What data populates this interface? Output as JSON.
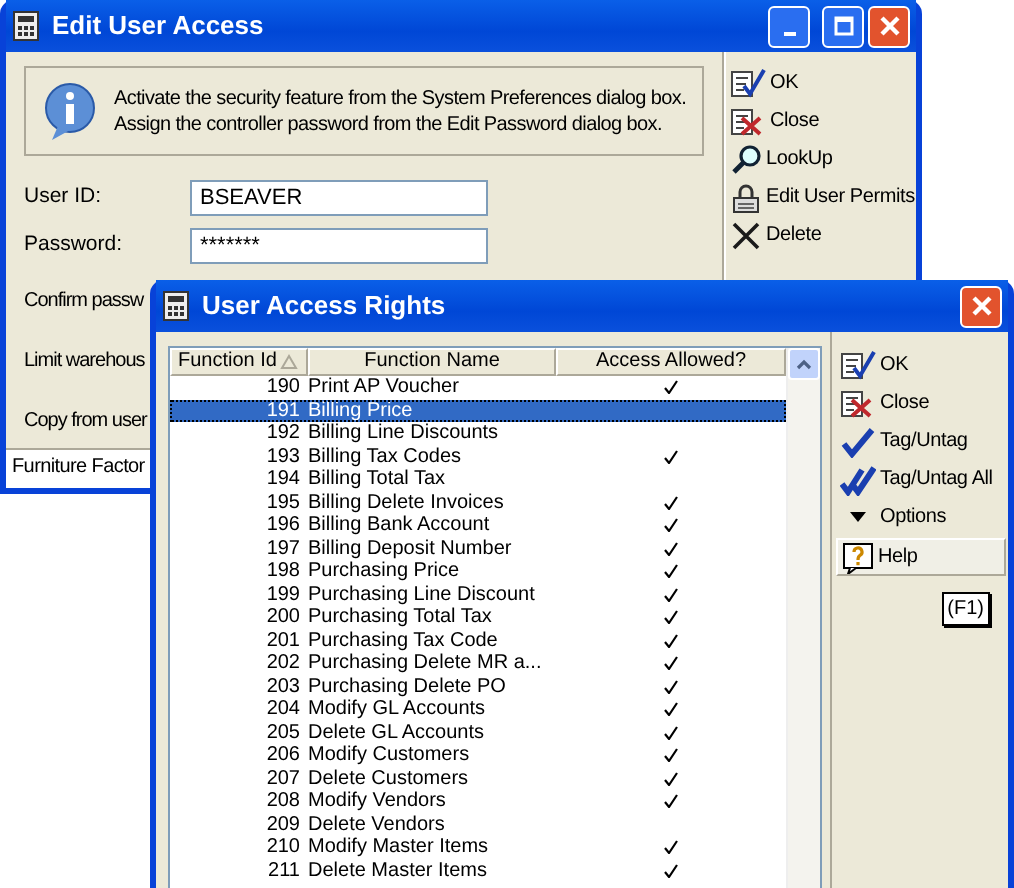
{
  "edit_window": {
    "title": "Edit User Access",
    "info": [
      "Activate the security feature from the System Preferences dialog box.",
      "Assign the controller password from the Edit Password dialog box."
    ],
    "fields": [
      {
        "label": "User ID:",
        "value": "BSEAVER"
      },
      {
        "label": "Password:",
        "value": "*******"
      }
    ],
    "labels": [
      "Confirm passw",
      "Limit warehous",
      "Copy from user"
    ],
    "status": "Furniture Factor",
    "buttons": [
      {
        "label": "OK",
        "kind": "ok"
      },
      {
        "label": "Close",
        "kind": "close"
      },
      {
        "label": "LookUp",
        "kind": "lookup"
      },
      {
        "label": "Edit User Permits",
        "kind": "permits"
      },
      {
        "label": "Delete",
        "kind": "delete"
      }
    ]
  },
  "rights_window": {
    "title": "User Access Rights",
    "columns": [
      "Function Id",
      "Function Name",
      "Access Allowed?"
    ],
    "rows": [
      {
        "id": "190",
        "name": "Print AP Voucher",
        "allowed": true,
        "selected": false
      },
      {
        "id": "191",
        "name": "Billing Price",
        "allowed": false,
        "selected": true
      },
      {
        "id": "192",
        "name": "Billing Line Discounts",
        "allowed": false,
        "selected": false
      },
      {
        "id": "193",
        "name": "Billing Tax Codes",
        "allowed": true,
        "selected": false
      },
      {
        "id": "194",
        "name": "Billing Total Tax",
        "allowed": false,
        "selected": false
      },
      {
        "id": "195",
        "name": "Billing Delete Invoices",
        "allowed": true,
        "selected": false
      },
      {
        "id": "196",
        "name": "Billing Bank Account",
        "allowed": true,
        "selected": false
      },
      {
        "id": "197",
        "name": "Billing Deposit Number",
        "allowed": true,
        "selected": false
      },
      {
        "id": "198",
        "name": "Purchasing Price",
        "allowed": true,
        "selected": false
      },
      {
        "id": "199",
        "name": "Purchasing Line Discount",
        "allowed": true,
        "selected": false
      },
      {
        "id": "200",
        "name": "Purchasing Total Tax",
        "allowed": true,
        "selected": false
      },
      {
        "id": "201",
        "name": "Purchasing Tax Code",
        "allowed": true,
        "selected": false
      },
      {
        "id": "202",
        "name": "Purchasing Delete MR a...",
        "allowed": true,
        "selected": false
      },
      {
        "id": "203",
        "name": "Purchasing Delete PO",
        "allowed": true,
        "selected": false
      },
      {
        "id": "204",
        "name": "Modify GL Accounts",
        "allowed": true,
        "selected": false
      },
      {
        "id": "205",
        "name": "Delete GL Accounts",
        "allowed": true,
        "selected": false
      },
      {
        "id": "206",
        "name": "Modify Customers",
        "allowed": true,
        "selected": false
      },
      {
        "id": "207",
        "name": "Delete Customers",
        "allowed": true,
        "selected": false
      },
      {
        "id": "208",
        "name": "Modify Vendors",
        "allowed": true,
        "selected": false
      },
      {
        "id": "209",
        "name": "Delete Vendors",
        "allowed": false,
        "selected": false
      },
      {
        "id": "210",
        "name": "Modify Master Items",
        "allowed": true,
        "selected": false
      },
      {
        "id": "211",
        "name": "Delete Master Items",
        "allowed": true,
        "selected": false
      }
    ],
    "buttons": [
      {
        "label": "OK",
        "kind": "ok"
      },
      {
        "label": "Close",
        "kind": "close"
      },
      {
        "label": "Tag/Untag",
        "kind": "tag"
      },
      {
        "label": "Tag/Untag All",
        "kind": "tagall"
      },
      {
        "label": "Options",
        "kind": "options"
      },
      {
        "label": "Help",
        "kind": "help"
      }
    ],
    "help_key": "(F1)"
  }
}
